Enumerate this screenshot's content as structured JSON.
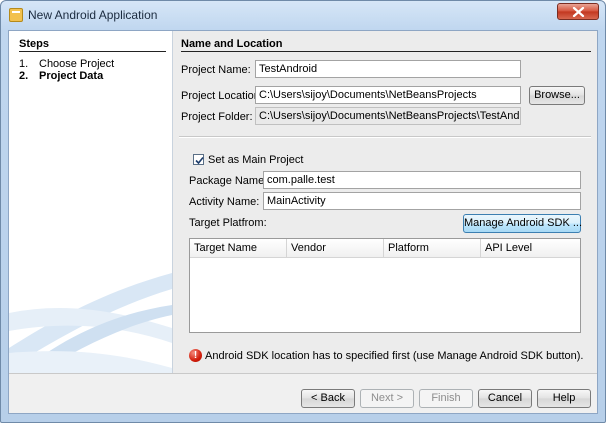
{
  "window": {
    "title": "New Android Application"
  },
  "steps": {
    "title": "Steps",
    "items": [
      {
        "num": "1.",
        "label": "Choose Project",
        "current": false
      },
      {
        "num": "2.",
        "label": "Project Data",
        "current": true
      }
    ]
  },
  "section": {
    "title": "Name and Location"
  },
  "project": {
    "name_label": "Project Name:",
    "name_value": "TestAndroid",
    "location_label": "Project Location:",
    "location_value": "C:\\Users\\sijoy\\Documents\\NetBeansProjects",
    "browse_label": "Browse...",
    "folder_label": "Project Folder:",
    "folder_value": "C:\\Users\\sijoy\\Documents\\NetBeansProjects\\TestAndroid"
  },
  "options": {
    "main_project_label": "Set as Main Project",
    "main_project_checked": true,
    "package_label": "Package Name:",
    "package_value": "com.palle.test",
    "activity_label": "Activity Name:",
    "activity_value": "MainActivity",
    "target_label": "Target Platfrom:",
    "manage_sdk_label": "Manage Android SDK ..."
  },
  "platform_table": {
    "columns": [
      "Target Name",
      "Vendor",
      "Platform",
      "API Level"
    ],
    "rows": []
  },
  "message": {
    "icon": "error-icon",
    "text": "Android SDK location has to specified first (use Manage Android SDK button)."
  },
  "buttons": {
    "back": "< Back",
    "next": "Next >",
    "finish": "Finish",
    "cancel": "Cancel",
    "help": "Help"
  },
  "colors": {
    "error": "#d21d0b",
    "titlebar": "#c9dcf1"
  }
}
